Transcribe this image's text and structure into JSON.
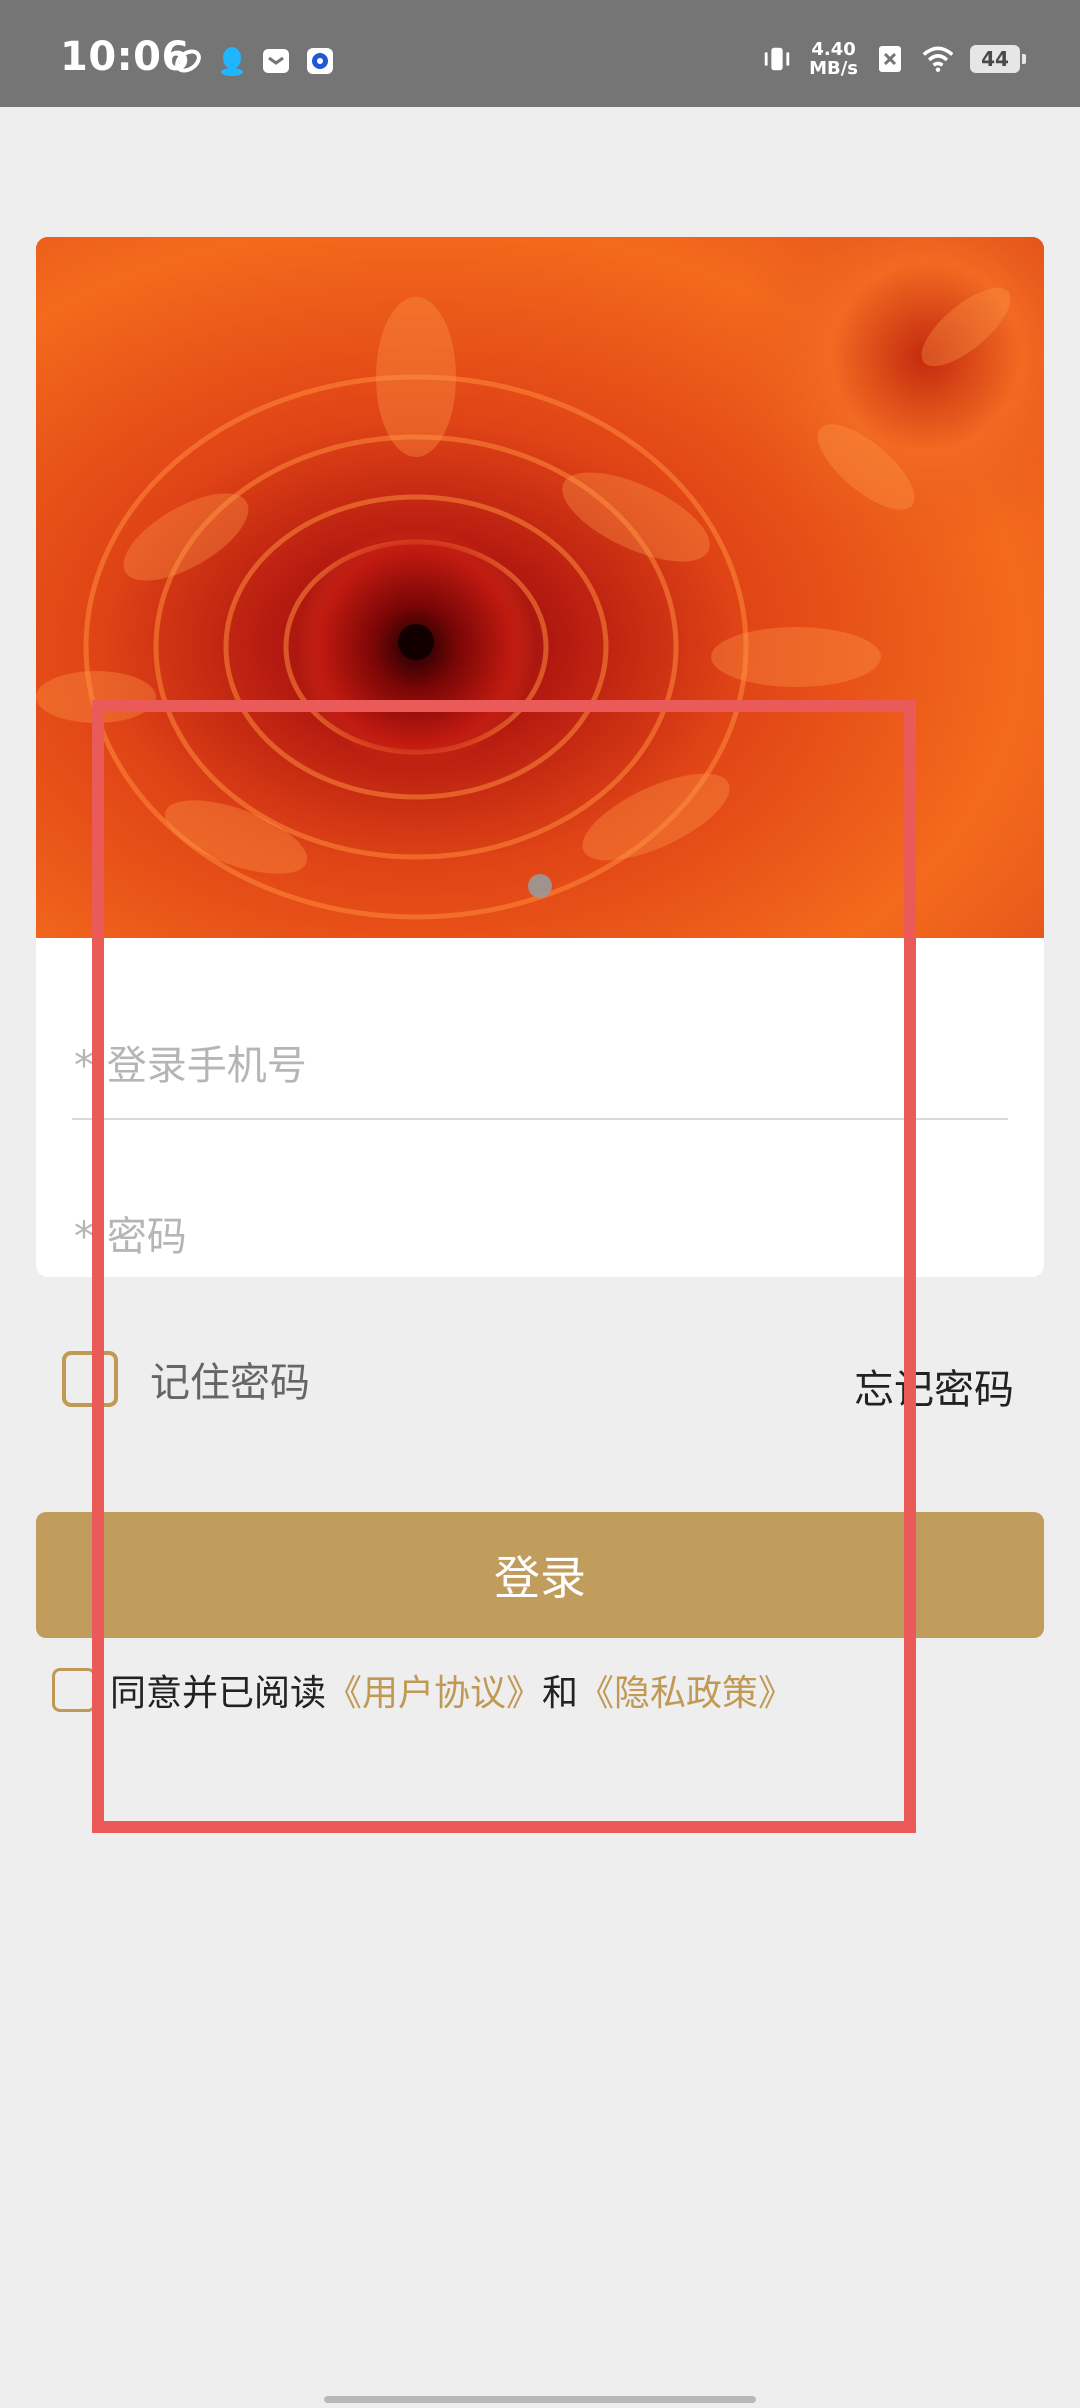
{
  "status_bar": {
    "time": "10:06",
    "net_speed_value": "4.40",
    "net_speed_unit": "MB/s",
    "battery": "44",
    "icons": [
      "swirl-app-icon",
      "qq-icon",
      "mail-icon",
      "browser-icon",
      "vibrate-icon",
      "no-sim-icon",
      "wifi-icon",
      "battery-icon"
    ]
  },
  "login": {
    "phone_placeholder": "* 登录手机号",
    "password_placeholder": "* 密码",
    "remember_label": "记住密码",
    "forgot_label": "忘记密码",
    "login_button": "登录",
    "agree_prefix": "同意并已阅读",
    "user_agreement": "《用户协议》",
    "and_text": "和",
    "privacy_policy": "《隐私政策》"
  },
  "colors": {
    "accent": "#c09d5c",
    "annotation_red": "#ea5a58",
    "status_bar": "#757575"
  }
}
